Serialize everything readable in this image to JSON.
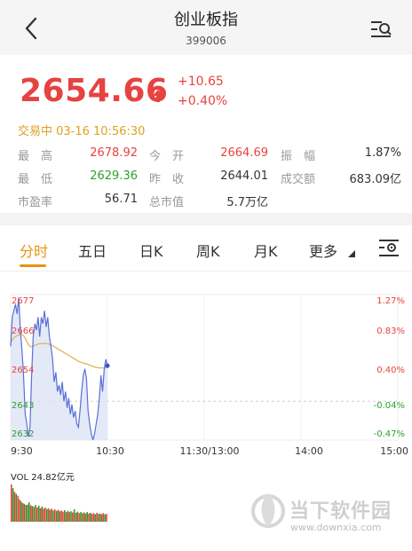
{
  "header": {
    "title": "创业板指",
    "code": "399006"
  },
  "quote": {
    "price": "2654.66",
    "change": "+10.65",
    "change_pct": "+0.40%",
    "status": "交易中 03-16 10:56:30",
    "rows": [
      [
        {
          "label": "最　高",
          "value": "2678.92",
          "color": "#e64340"
        },
        {
          "label": "今　开",
          "value": "2664.69",
          "color": "#e64340"
        },
        {
          "label": "振　幅",
          "value": "1.87%",
          "color": "#333333"
        }
      ],
      [
        {
          "label": "最　低",
          "value": "2629.36",
          "color": "#2ca02c"
        },
        {
          "label": "昨　收",
          "value": "2644.01",
          "color": "#333333"
        },
        {
          "label": "成交额",
          "value": "683.09亿",
          "color": "#333333"
        }
      ],
      [
        {
          "label": "市盈率",
          "value": "56.71",
          "color": "#333333"
        },
        {
          "label": "总市值",
          "value": "5.7万亿",
          "color": "#333333"
        },
        {
          "label": "",
          "value": "",
          "color": "#333333"
        }
      ]
    ]
  },
  "tabs": [
    "分时",
    "五日",
    "日K",
    "周K",
    "月K",
    "更多"
  ],
  "chart_data": {
    "type": "line",
    "y_left_ticks": [
      "2677",
      "2666",
      "2654",
      "2643",
      "2632"
    ],
    "y_right_ticks": [
      "1.27%",
      "0.83%",
      "0.40%",
      "-0.04%",
      "-0.47%"
    ],
    "x_ticks": [
      "9:30",
      "10:30",
      "11:30/13:00",
      "14:00",
      "15:00"
    ],
    "ylim": [
      2632,
      2677
    ],
    "prev_close": 2644.01,
    "price_series": [
      2661,
      2670,
      2672,
      2674,
      2671,
      2676,
      2666,
      2660,
      2652,
      2640,
      2637,
      2633,
      2636,
      2652,
      2664,
      2668,
      2666,
      2670,
      2664,
      2670,
      2668,
      2672,
      2667,
      2670,
      2664,
      2661,
      2657,
      2650,
      2653,
      2647,
      2649,
      2646,
      2650,
      2644,
      2647,
      2642,
      2645,
      2640,
      2643,
      2639,
      2641,
      2637,
      2636,
      2641,
      2647,
      2652,
      2654,
      2651,
      2641,
      2637,
      2634,
      2632,
      2634,
      2637,
      2640,
      2645,
      2652,
      2647,
      2654,
      2657,
      2655
    ],
    "avg_series": [
      2662,
      2663,
      2663.6,
      2664,
      2664.3,
      2664.5,
      2664.7,
      2664.6,
      2664.3,
      2663.5,
      2662.5,
      2661.5,
      2661,
      2660.8,
      2661,
      2661.3,
      2661.5,
      2661.7,
      2661.8,
      2661.8,
      2661.8,
      2661.9,
      2661.9,
      2661.8,
      2661.6,
      2661.4,
      2661.2,
      2660.9,
      2660.6,
      2660.3,
      2660,
      2659.7,
      2659.4,
      2659.1,
      2658.8,
      2658.5,
      2658.2,
      2657.9,
      2657.6,
      2657.3,
      2657,
      2656.7,
      2656.4,
      2656.2,
      2656,
      2655.8,
      2655.7,
      2655.6,
      2655.4,
      2655.2,
      2655,
      2654.8,
      2654.6,
      2654.5,
      2654.4,
      2654.3,
      2654.3,
      2654.3,
      2654.3,
      2654.4,
      2654.4
    ],
    "volume_label": "VOL 24.82亿元",
    "volume": [
      10,
      9,
      8,
      7.5,
      7,
      6,
      5.5,
      5,
      4.8,
      4.5,
      4.6,
      5.2,
      4.4,
      4.2,
      4,
      4.5,
      3.8,
      4.3,
      3.6,
      4.1,
      3.5,
      3.8,
      3.4,
      3.6,
      3.2,
      3.5,
      3,
      3.3,
      2.9,
      3.2,
      2.8,
      3,
      2.7,
      3.1,
      2.6,
      2.9,
      2.6,
      2.8,
      2.5,
      3.3,
      2.4,
      2.7,
      2.3,
      2.6,
      2.3,
      2.5,
      2.2,
      2.6,
      2.2,
      2.4,
      2.1,
      2.3,
      2,
      2.4,
      2.1,
      2.2,
      2,
      2.3,
      2,
      2.1
    ],
    "volume_colors": [
      "#e64340",
      "#2ca02c",
      "#e64340",
      "#2ca02c",
      "#e64340",
      "#e64340",
      "#2ca02c",
      "#e64340",
      "#2ca02c",
      "#e64340",
      "#2ca02c",
      "#2ca02c",
      "#e64340",
      "#2ca02c",
      "#e64340",
      "#2ca02c",
      "#e64340",
      "#2ca02c",
      "#e64340",
      "#2ca02c",
      "#e64340",
      "#e64340",
      "#2ca02c",
      "#e64340",
      "#2ca02c",
      "#e64340",
      "#2ca02c",
      "#e64340",
      "#2ca02c",
      "#e64340",
      "#2ca02c",
      "#e64340",
      "#e64340",
      "#2ca02c",
      "#e64340",
      "#2ca02c",
      "#e64340",
      "#2ca02c",
      "#e64340",
      "#2ca02c",
      "#e64340",
      "#2ca02c",
      "#e64340",
      "#2ca02c",
      "#e64340",
      "#2ca02c",
      "#e64340",
      "#2ca02c",
      "#e64340",
      "#2ca02c",
      "#e64340",
      "#e64340",
      "#2ca02c",
      "#e64340",
      "#2ca02c",
      "#e64340",
      "#2ca02c",
      "#e64340",
      "#2ca02c",
      "#e64340"
    ]
  },
  "watermark": {
    "text": "当下软件园",
    "url": "www.downxia.com"
  },
  "colors": {
    "up": "#e64340",
    "down": "#2ca02c",
    "accent": "#e8930c",
    "avg_line": "#e0b050",
    "price_line": "#5a6fd8"
  }
}
